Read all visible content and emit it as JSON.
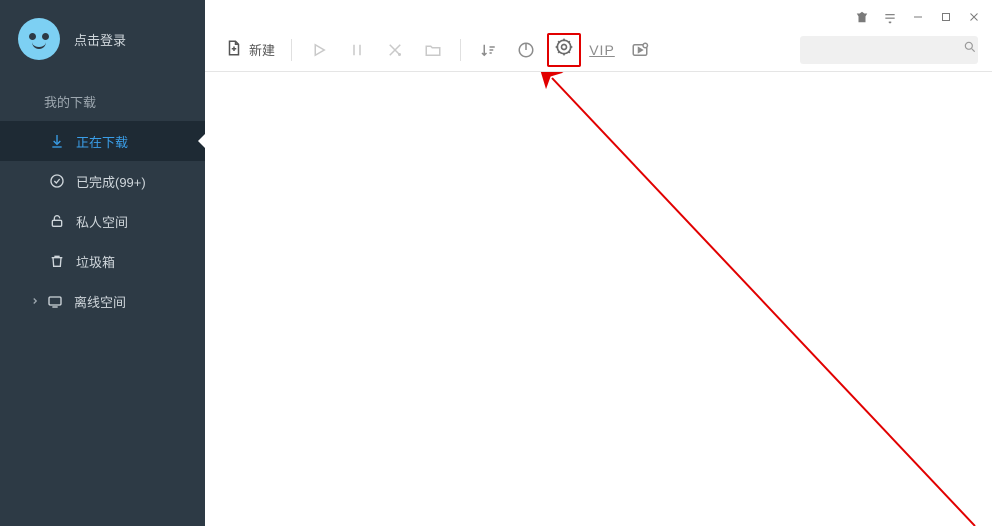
{
  "user": {
    "login_text": "点击登录"
  },
  "sidebar": {
    "section_title": "我的下载",
    "items": [
      {
        "label": "正在下载"
      },
      {
        "label": "已完成(99+)"
      },
      {
        "label": "私人空间"
      },
      {
        "label": "垃圾箱"
      }
    ],
    "offline_label": "离线空间"
  },
  "toolbar": {
    "new_label": "新建",
    "vip_label": "VIP"
  },
  "search": {
    "placeholder": ""
  },
  "colors": {
    "highlight": "#e10000",
    "accent": "#3a9ee8",
    "sidebar": "#2d3a45"
  }
}
